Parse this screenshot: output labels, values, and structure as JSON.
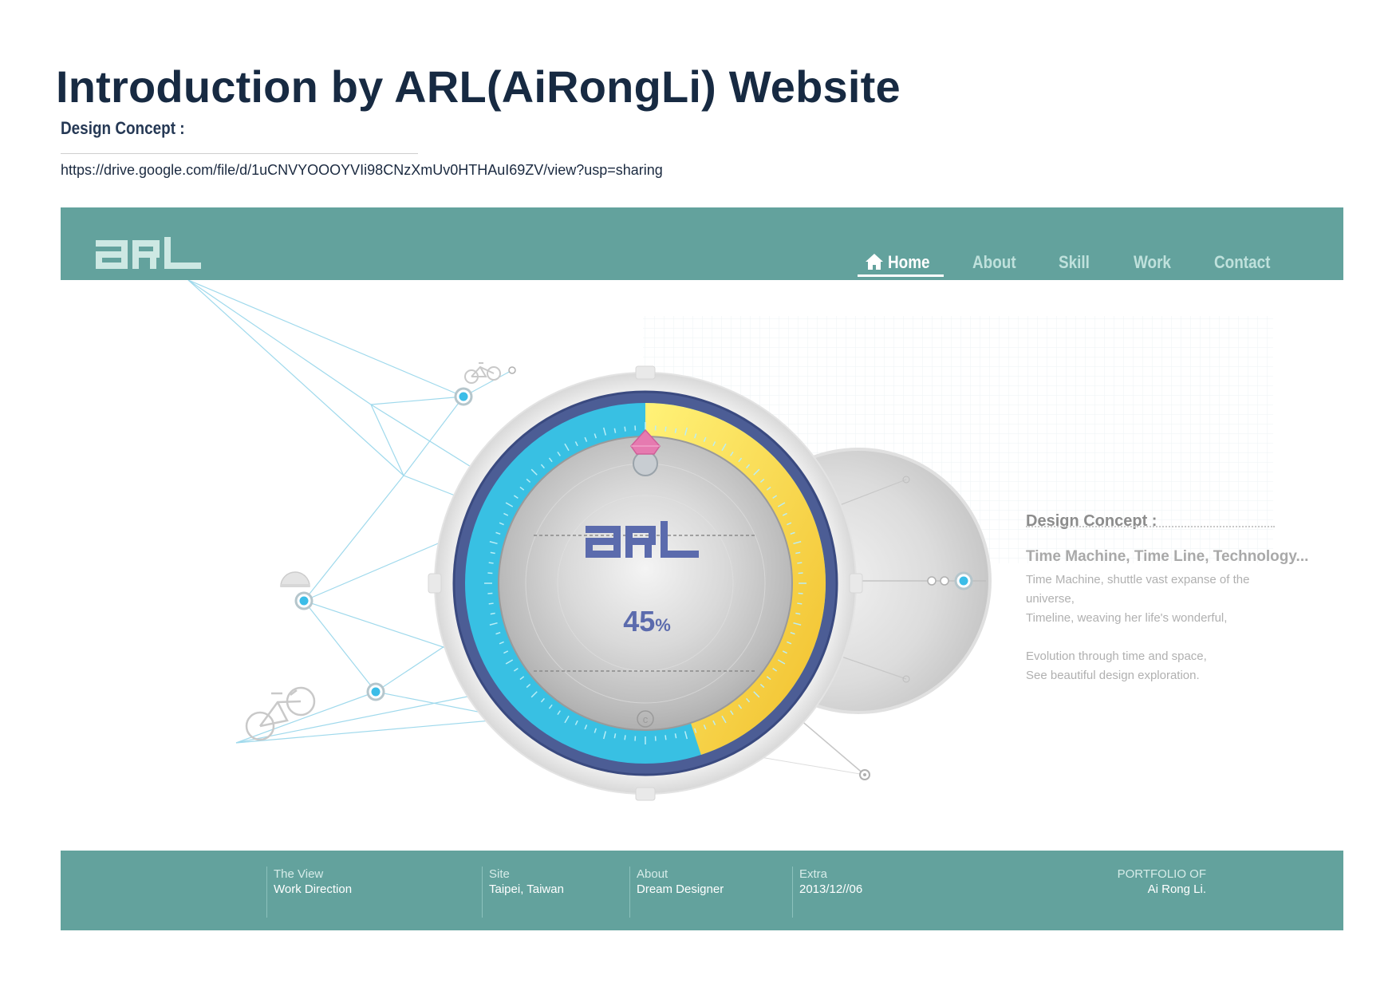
{
  "document": {
    "title": "Introduction by ARL(AiRongLi) Website",
    "subtitle": "Design Concept :",
    "link": "https://drive.google.com/file/d/1uCNVYOOOYVIi98CNzXmUv0HTHAuI69ZV/view?usp=sharing"
  },
  "site": {
    "logo_text": "ARL",
    "nav": [
      {
        "label": "Home",
        "active": true
      },
      {
        "label": "About",
        "active": false
      },
      {
        "label": "Skill",
        "active": false
      },
      {
        "label": "Work",
        "active": false
      },
      {
        "label": "Contact",
        "active": false
      }
    ],
    "dial": {
      "logo_text": "ARL",
      "progress_value": "45",
      "progress_unit": "%",
      "progress_fraction": 0.45
    },
    "concept": {
      "heading": "Design Concept :",
      "tagline": "Time Machine, Time Line, Technology...",
      "lines": [
        "Time Machine, shuttle vast expanse of the",
        "universe,",
        "Timeline, weaving her life's wonderful,",
        "",
        "Evolution through time and space,",
        "See beautiful design exploration."
      ]
    },
    "footer": {
      "columns": [
        {
          "label": "The View",
          "value": "Work Direction"
        },
        {
          "label": "Site",
          "value": "Taipei, Taiwan"
        },
        {
          "label": "About",
          "value": "Dream Designer"
        },
        {
          "label": "Extra",
          "value": "2013/12//06"
        }
      ],
      "portfolio_label": "PORTFOLIO OF",
      "portfolio_name": "Ai Rong Li."
    },
    "colors": {
      "teal": "#63a29d",
      "cyan": "#36bfe0",
      "yellow": "#f7e04a",
      "navy": "#4a5b93",
      "pink": "#e67ab0"
    },
    "icons": [
      "home-icon",
      "bicycle-icon",
      "helmet-icon",
      "copyright-icon",
      "gem-marker-icon"
    ]
  }
}
